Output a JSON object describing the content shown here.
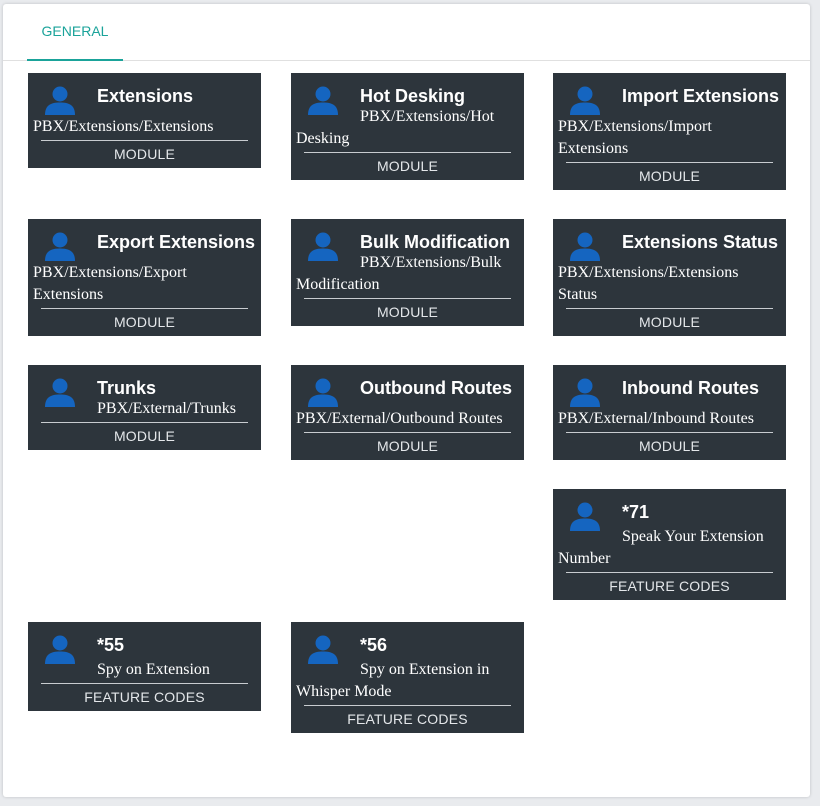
{
  "tabs": [
    {
      "label": "GENERAL",
      "active": true
    }
  ],
  "cards": [
    {
      "title": "Extensions",
      "path": "PBX/Extensions/Extensions",
      "type": "MODULE"
    },
    {
      "title": "Hot Desking",
      "path": "PBX/Extensions/Hot Desking",
      "type": "MODULE"
    },
    {
      "title": "Import Extensions",
      "path": "PBX/Extensions/Import Extensions",
      "type": "MODULE"
    },
    {
      "title": "Export Extensions",
      "path": "PBX/Extensions/Export Extensions",
      "type": "MODULE"
    },
    {
      "title": "Bulk Modification",
      "path": "PBX/Extensions/Bulk Modification",
      "type": "MODULE"
    },
    {
      "title": "Extensions Status",
      "path": "PBX/Extensions/Extensions Status",
      "type": "MODULE"
    },
    {
      "title": "Trunks",
      "path": "PBX/External/Trunks",
      "type": "MODULE"
    },
    {
      "title": "Outbound Routes",
      "path": "PBX/External/Outbound Routes",
      "type": "MODULE"
    },
    {
      "title": "Inbound Routes",
      "path": "PBX/External/Inbound Routes",
      "type": "MODULE"
    },
    {
      "title": "*71",
      "path": "Speak Your Extension Number",
      "type": "FEATURE CODES"
    },
    {
      "title": "*55",
      "path": "Spy on Extension",
      "type": "FEATURE CODES"
    },
    {
      "title": "*56",
      "path": "Spy on Extension in Whisper Mode",
      "type": "FEATURE CODES"
    }
  ],
  "colors": {
    "card_bg": "#2d353c",
    "icon": "#1565c0",
    "tab_accent": "#1aa39a"
  },
  "icon": "user-icon"
}
